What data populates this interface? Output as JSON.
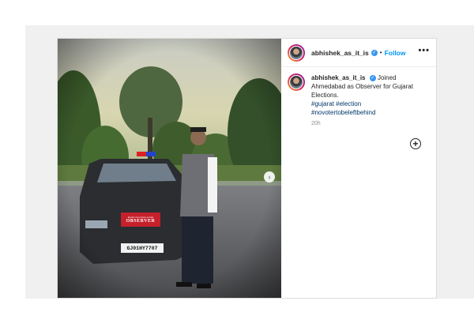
{
  "post": {
    "username": "abhishek_as_it_is",
    "verified_glyph": "✓",
    "separator": "•",
    "follow_label": "Follow",
    "more_icon": "•••",
    "caption": {
      "text": "Joined Ahmedabad as Observer for Gujarat Elections.",
      "hashtags": [
        "#gujarat",
        "#election",
        "#novotertobeleftbehind"
      ]
    },
    "time_ago": "20h",
    "add_comment_icon": "+"
  },
  "media": {
    "car_board_line1": "Election Commission of India",
    "car_board_line2": "OBSERVER",
    "plate": "GJ01HY7707",
    "next_arrow": "›"
  },
  "colors": {
    "accent": "#0095f6",
    "verified": "#3897f0",
    "text": "#262626",
    "muted": "#8e8e8e"
  }
}
